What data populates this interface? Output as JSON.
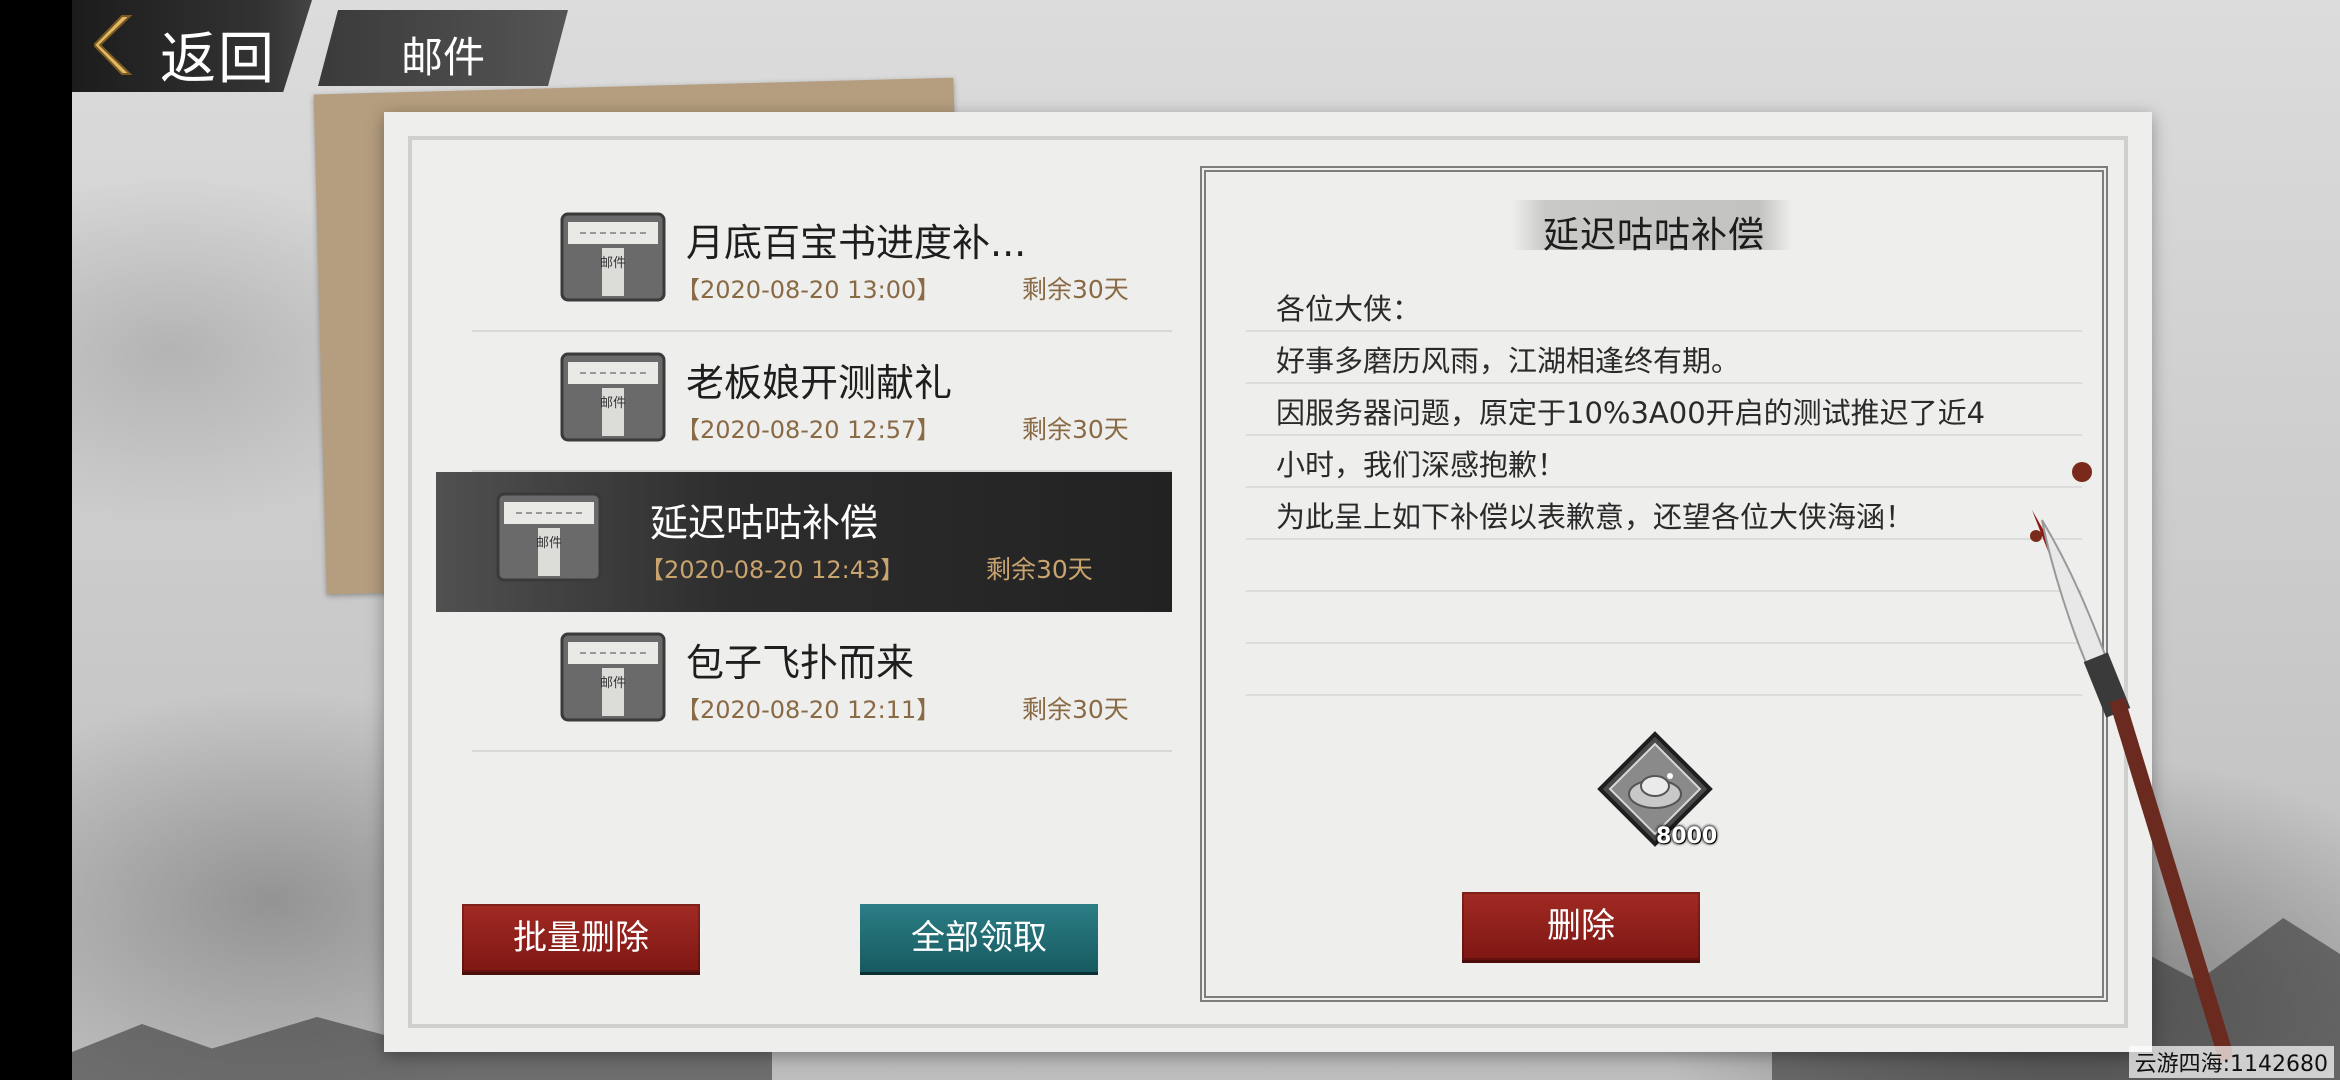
{
  "topbar": {
    "back_label": "返回",
    "title": "邮件"
  },
  "mails": [
    {
      "title": "月底百宝书进度补...",
      "date": "【2020-08-20 13:00】",
      "remaining": "剩余30天",
      "envelope_text": "邮件",
      "selected": false
    },
    {
      "title": "老板娘开测献礼",
      "date": "【2020-08-20 12:57】",
      "remaining": "剩余30天",
      "envelope_text": "邮件",
      "selected": false
    },
    {
      "title": "延迟咕咕补偿",
      "date": "【2020-08-20 12:43】",
      "remaining": "剩余30天",
      "envelope_text": "邮件",
      "selected": true
    },
    {
      "title": "包子飞扑而来",
      "date": "【2020-08-20 12:11】",
      "remaining": "剩余30天",
      "envelope_text": "邮件",
      "selected": false
    }
  ],
  "buttons": {
    "batch_delete": "批量删除",
    "claim_all": "全部领取",
    "delete": "删除"
  },
  "detail": {
    "title": "延迟咕咕补偿",
    "body": [
      "各位大侠：",
      "好事多磨历风雨，江湖相逢终有期。",
      "因服务器问题，原定于10%3A00开启的测试推迟了近4",
      "小时，我们深感抱歉！",
      "为此呈上如下补偿以表歉意，还望各位大侠海涵！"
    ],
    "reward": {
      "icon": "silver-ingot-icon",
      "count": "8000"
    }
  },
  "watermark": "云游四海:1142680",
  "colors": {
    "accent_red": "#8f1f1a",
    "accent_teal": "#1f6b72",
    "date_brown": "#8a6a45"
  }
}
